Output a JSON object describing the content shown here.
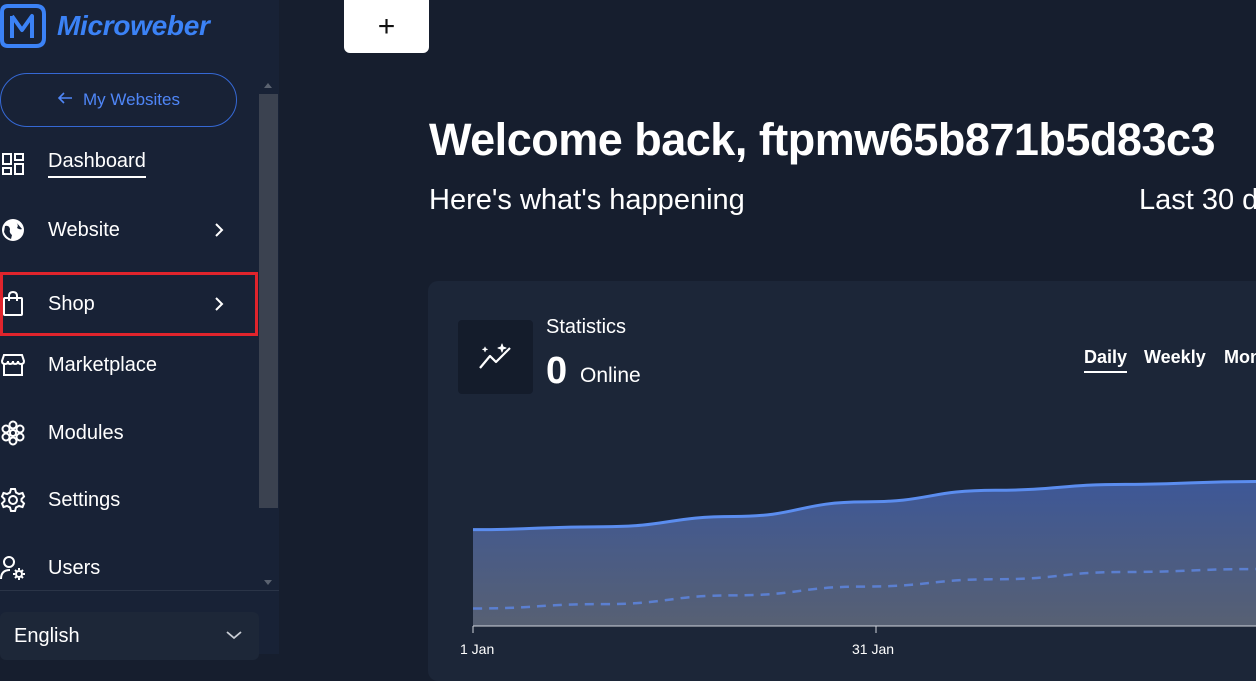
{
  "brand": {
    "name": "Microweber",
    "color": "#3b82f6"
  },
  "sidebar": {
    "back_button": "My Websites",
    "items": [
      {
        "label": "Dashboard",
        "icon": "dashboard-grid-icon",
        "active": true
      },
      {
        "label": "Website",
        "icon": "globe-icon",
        "has_submenu": true
      },
      {
        "label": "Shop",
        "icon": "shopping-bag-icon",
        "has_submenu": true,
        "highlighted": true
      },
      {
        "label": "Marketplace",
        "icon": "storefront-icon"
      },
      {
        "label": "Modules",
        "icon": "modules-hexagon-icon"
      },
      {
        "label": "Settings",
        "icon": "gear-icon"
      },
      {
        "label": "Users",
        "icon": "users-gear-icon"
      }
    ],
    "language": "English"
  },
  "toolbar": {
    "add_label": "+"
  },
  "main": {
    "welcome": "Welcome back, ftpmw65b871b5d83c3",
    "subtitle": "Here's what's happening",
    "period": "Last 30 d"
  },
  "stats": {
    "title": "Statistics",
    "online_count": "0",
    "online_label": "Online",
    "tabs": [
      {
        "label": "Daily",
        "active": true
      },
      {
        "label": "Weekly",
        "active": false
      },
      {
        "label": "Mon",
        "active": false
      }
    ]
  },
  "colors": {
    "background": "#161e2e",
    "sidebar": "#182236",
    "accent": "#3b82f6",
    "highlight_border": "#e0242c",
    "line": "#5b8def"
  },
  "chart_data": {
    "type": "area",
    "x_tick_labels": [
      "1 Jan",
      "31 Jan"
    ],
    "series": [
      {
        "style": "solid",
        "values": [
          0.66,
          0.68,
          0.75,
          0.85,
          0.93,
          0.97,
          0.99
        ]
      },
      {
        "style": "dashed",
        "values": [
          0.12,
          0.15,
          0.21,
          0.27,
          0.32,
          0.37,
          0.39
        ]
      }
    ]
  }
}
